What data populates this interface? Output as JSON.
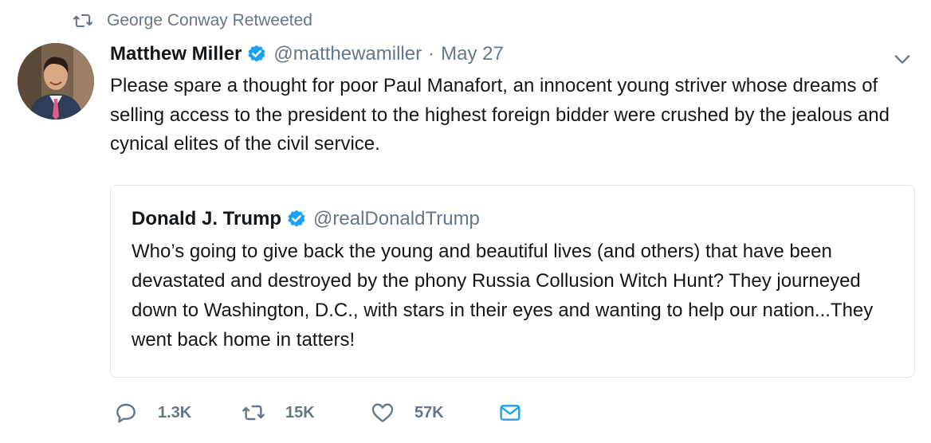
{
  "retweet_context": {
    "text": "George Conway Retweeted"
  },
  "tweet": {
    "author_name": "Matthew Miller",
    "handle": "@matthewamiller",
    "separator": "·",
    "date": "May 27",
    "text": "Please spare a thought for poor Paul Manafort, an innocent young striver whose dreams of selling access to the president to the highest foreign bidder were crushed by the jealous and cynical elites of the civil service."
  },
  "quoted_tweet": {
    "author_name": "Donald J. Trump",
    "handle": "@realDonaldTrump",
    "text": "Who’s going to give back the young and beautiful lives (and others) that have been devastated and destroyed by the phony Russia Collusion Witch Hunt? They journeyed down to Washington, D.C., with stars in their eyes and wanting to help our nation...They went back home in tatters!"
  },
  "actions": {
    "replies": "1.3K",
    "retweets": "15K",
    "likes": "57K"
  },
  "colors": {
    "verified": "#1da1f2",
    "muted": "#657786",
    "text": "#14171a",
    "border": "#e1e8ed",
    "message_icon": "#1da1f2"
  },
  "icons": {
    "retweet": "retweet-icon",
    "verified": "verified-badge-icon",
    "menu": "chevron-down-icon",
    "reply": "reply-icon",
    "like": "heart-icon",
    "message": "envelope-icon"
  }
}
